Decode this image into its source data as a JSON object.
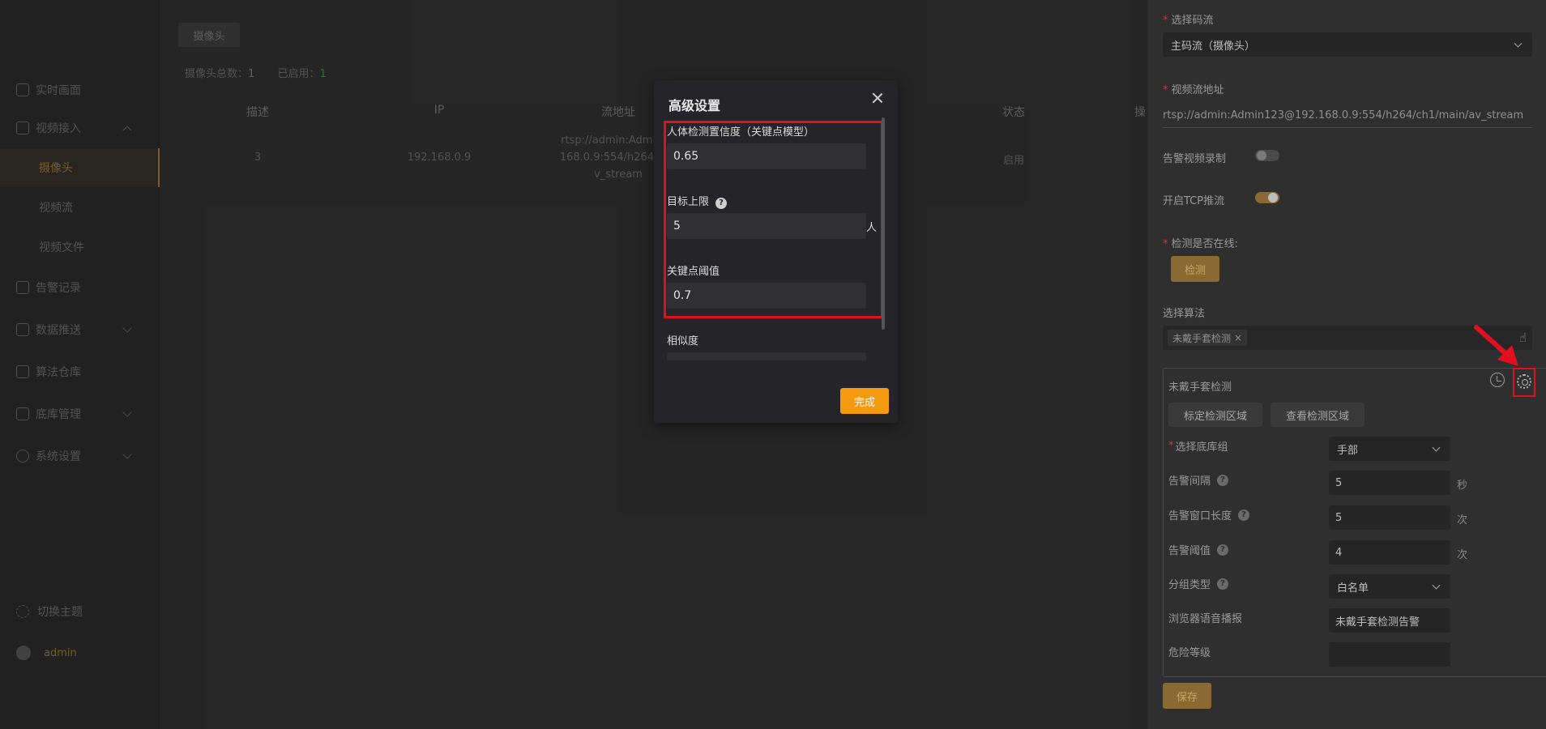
{
  "sidebar": {
    "items": [
      {
        "label": "实时画面"
      },
      {
        "label": "视频接入"
      },
      {
        "label": "告警记录"
      },
      {
        "label": "数据推送"
      },
      {
        "label": "算法仓库"
      },
      {
        "label": "底库管理"
      },
      {
        "label": "系统设置"
      }
    ],
    "subitems": [
      {
        "label": "摄像头"
      },
      {
        "label": "视频流"
      },
      {
        "label": "视频文件"
      }
    ],
    "theme_label": "切换主题",
    "user": "admin"
  },
  "main": {
    "tab": "摄像头",
    "summary": {
      "total_label": "摄像头总数：",
      "total": "1",
      "enabled_label": "已启用：",
      "enabled": "1"
    },
    "columns": [
      "描述",
      "IP",
      "流地址",
      "状态",
      "操"
    ],
    "row": {
      "desc": "3",
      "ip": "192.168.0.9",
      "stream_l1": "rtsp://admin:Admin12",
      "stream_l2": "168.0.9:554/h264/ch1",
      "stream_l3": "v_stream",
      "status": "启用"
    }
  },
  "panel": {
    "stream_type_label": "选择码流",
    "stream_type_value": "主码流（摄像头）",
    "video_url_label": "视频流地址",
    "video_url_value": "rtsp://admin:Admin123@192.168.0.9:554/h264/ch1/main/av_stream",
    "alarm_record_label": "告警视频录制",
    "tcp_label": "开启TCP推流",
    "online_label": "检测是否在线:",
    "detect_button": "检测",
    "algo_label": "选择算法",
    "algo_chip": "未戴手套检测",
    "card": {
      "title": "未戴手套检测",
      "mark_area": "标定检测区域",
      "view_area": "查看检测区域",
      "fields": [
        {
          "label": "选择底库组",
          "value": "手部",
          "unit": ""
        },
        {
          "label": "告警间隔",
          "value": "5",
          "unit": "秒"
        },
        {
          "label": "告警窗口长度",
          "value": "5",
          "unit": "次"
        },
        {
          "label": "告警阈值",
          "value": "4",
          "unit": "次"
        },
        {
          "label": "分组类型",
          "value": "白名单",
          "unit": ""
        },
        {
          "label": "浏览器语音播报",
          "value": "未戴手套检测告警",
          "unit": ""
        },
        {
          "label": "危险等级",
          "value": "",
          "unit": ""
        }
      ]
    },
    "save_button": "保存"
  },
  "modal": {
    "title": "高级设置",
    "fields": [
      {
        "label": "人体检测置信度（关键点模型）",
        "value": "0.65"
      },
      {
        "label": "目标上限",
        "value": "5",
        "unit": "人"
      },
      {
        "label": "关键点阈值",
        "value": "0.7"
      },
      {
        "label": "相似度",
        "value": ""
      }
    ],
    "done_button": "完成"
  },
  "colors": {
    "accent": "#f59a0e",
    "highlight": "#e0101e",
    "gold": "#8a6a32"
  }
}
